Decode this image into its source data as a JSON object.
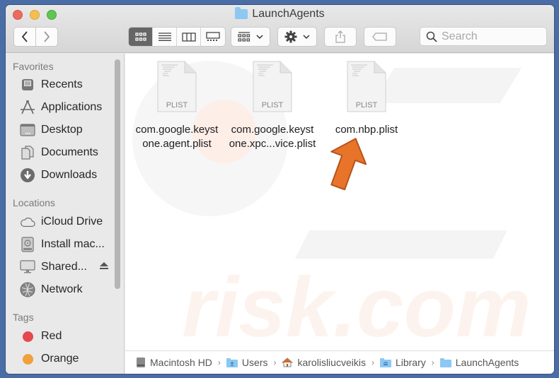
{
  "window": {
    "title": "LaunchAgents",
    "folder_icon": "folder-icon"
  },
  "toolbar": {
    "back_icon": "chevron-left-icon",
    "forward_icon": "chevron-right-icon",
    "view_modes": [
      {
        "name": "icon-view",
        "active": true
      },
      {
        "name": "list-view",
        "active": false
      },
      {
        "name": "column-view",
        "active": false
      },
      {
        "name": "gallery-view",
        "active": false
      }
    ],
    "group_icon": "group-by-icon",
    "action_icon": "gear-icon",
    "share_icon": "share-icon",
    "tag_icon": "tag-icon",
    "search": {
      "placeholder": "Search",
      "value": ""
    }
  },
  "sidebar": {
    "favorites_header": "Favorites",
    "favorites": [
      {
        "label": "Recents",
        "icon": "recents-icon"
      },
      {
        "label": "Applications",
        "icon": "applications-icon"
      },
      {
        "label": "Desktop",
        "icon": "desktop-icon"
      },
      {
        "label": "Documents",
        "icon": "documents-icon"
      },
      {
        "label": "Downloads",
        "icon": "downloads-icon"
      }
    ],
    "locations_header": "Locations",
    "locations": [
      {
        "label": "iCloud Drive",
        "icon": "cloud-icon"
      },
      {
        "label": "Install mac...",
        "icon": "disk-image-icon"
      },
      {
        "label": "Shared...",
        "icon": "display-icon",
        "eject": true
      },
      {
        "label": "Network",
        "icon": "network-icon"
      }
    ],
    "tags_header": "Tags",
    "tags": [
      {
        "label": "Red",
        "color": "#e5484d"
      },
      {
        "label": "Orange",
        "color": "#f0a03c"
      }
    ]
  },
  "files": [
    {
      "name_line1": "com.google.keyst",
      "name_line2": "one.agent.plist",
      "type": "PLIST"
    },
    {
      "name_line1": "com.google.keyst",
      "name_line2": "one.xpc...vice.plist",
      "type": "PLIST"
    },
    {
      "name_line1": "com.nbp.plist",
      "name_line2": "",
      "type": "PLIST"
    }
  ],
  "pathbar": [
    {
      "label": "Macintosh HD",
      "icon": "hard-drive-icon"
    },
    {
      "label": "Users",
      "icon": "users-folder-icon"
    },
    {
      "label": "karolisliucveikis",
      "icon": "home-icon"
    },
    {
      "label": "Library",
      "icon": "library-folder-icon"
    },
    {
      "label": "LaunchAgents",
      "icon": "folder-icon"
    }
  ],
  "annotation": {
    "arrow_color": "#e8742a",
    "points_to": "com.nbp.plist"
  }
}
